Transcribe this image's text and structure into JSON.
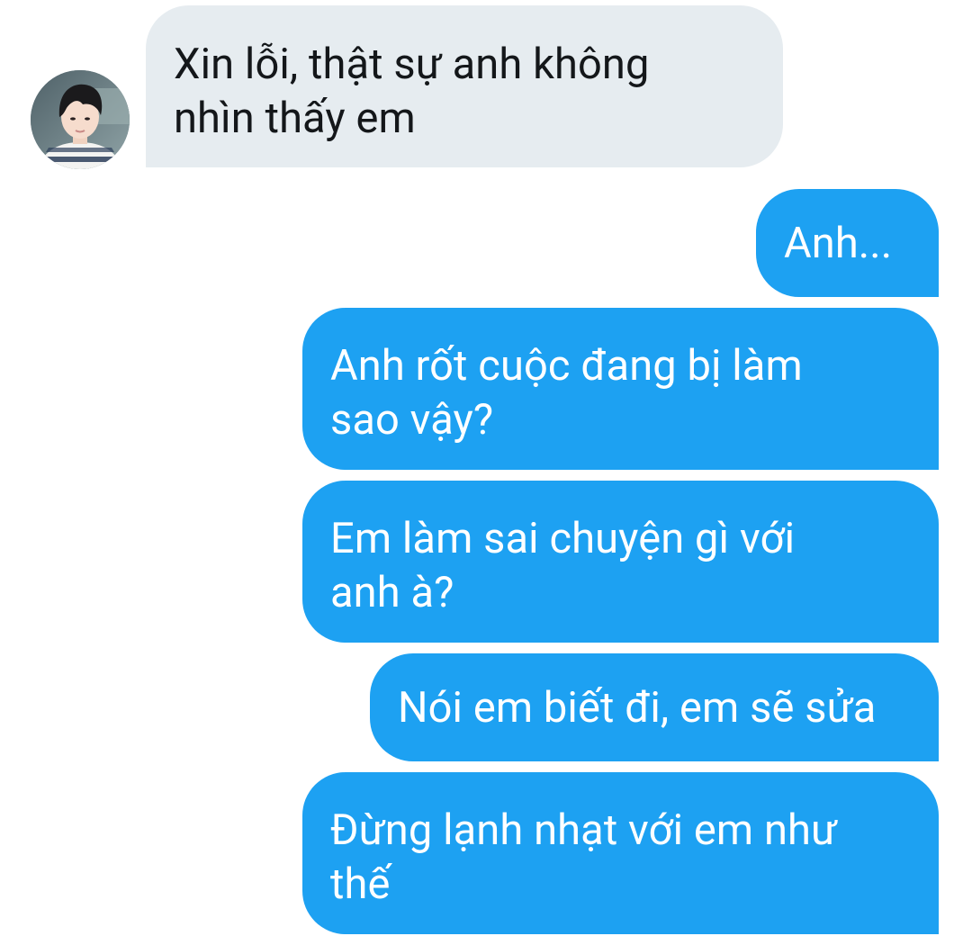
{
  "conversation": {
    "contact": {
      "avatar_icon": "avatar-photo"
    },
    "messages": [
      {
        "direction": "incoming",
        "text": "Xin lỗi, thật sự anh không\nnhìn thấy em"
      },
      {
        "direction": "outgoing",
        "text": "Anh..."
      },
      {
        "direction": "outgoing",
        "text": "Anh rốt cuộc đang bị làm\nsao vậy?"
      },
      {
        "direction": "outgoing",
        "text": "Em làm sai chuyện gì với\nanh à?"
      },
      {
        "direction": "outgoing",
        "text": "Nói em biết đi, em sẽ sửa"
      },
      {
        "direction": "outgoing",
        "text": "Đừng lạnh nhạt với em như\nthế"
      }
    ]
  },
  "colors": {
    "incoming_bubble": "#e6ecf0",
    "outgoing_bubble": "#1da1f2",
    "incoming_text": "#14171a",
    "outgoing_text": "#ffffff",
    "background": "#ffffff"
  }
}
